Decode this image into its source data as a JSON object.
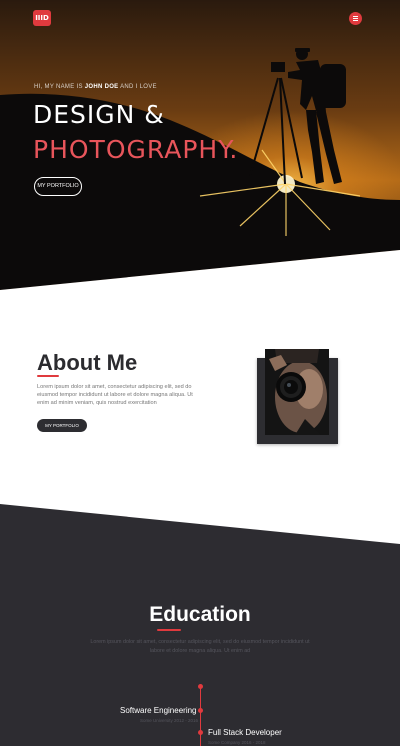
{
  "brand": {
    "logo_text": "IIID",
    "accent_color": "#e03a3e"
  },
  "nav": {
    "menu_icon": "hamburger-icon"
  },
  "hero": {
    "intro_prefix": "HI, MY NAME IS",
    "name": "JOHN DOE",
    "intro_suffix": "AND I LOVE",
    "title_line1": "DESIGN &",
    "title_line2": "PHOTOGRAPHY.",
    "button_label": "MY PORTFOLIO"
  },
  "about": {
    "title": "About Me",
    "text": "Lorem ipsum dolor sit amet, consectetur adipiscing elit, sed do eiusmod tempor incididunt ut labore et dolore magna aliqua. Ut enim ad minim veniam, quis nostrud exercitation",
    "button_label": "MY PORTFOLIO"
  },
  "education": {
    "title": "Education",
    "text": "Lorem ipsum dolor sit amet, consectetur adipiscing elit, sed do eiusmod tempor incididunt ut labore et dolore magna aliqua. Ut enim ad",
    "items": [
      {
        "title": "Software Engineering",
        "subtitle": "Some University 2012 - 2016"
      },
      {
        "title": "Full Stack Developer",
        "subtitle": "Some Company 2016 - 2018"
      }
    ]
  }
}
